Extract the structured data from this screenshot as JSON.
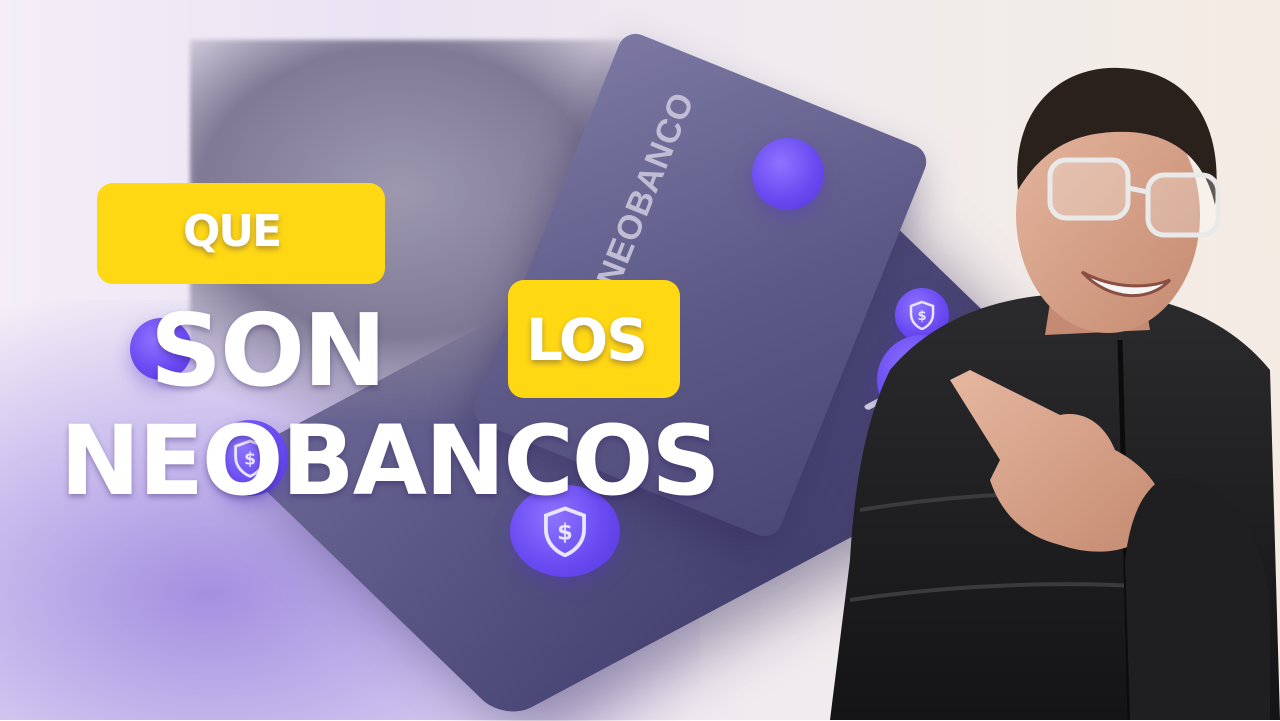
{
  "title": {
    "word1": "QUE",
    "word2": "SON",
    "word3": "LOS",
    "word4": "NEOBANCOS"
  },
  "card": {
    "brand": "NEOBANCO"
  },
  "colors": {
    "highlight": "#ffd814",
    "coin": "#6a4bf2",
    "jacket": "#1c1c1e"
  },
  "icons": [
    "shield-dollar-icon"
  ]
}
